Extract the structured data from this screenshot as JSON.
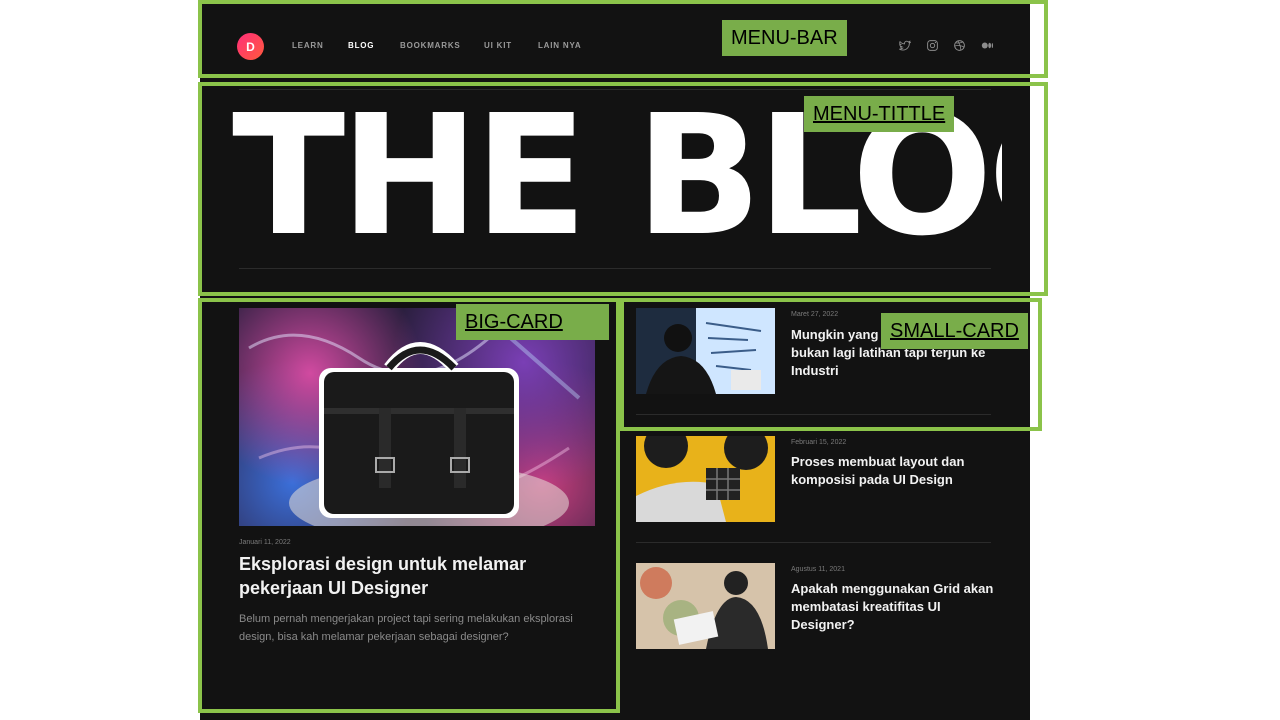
{
  "nav": {
    "logo_letter": "D",
    "items": [
      {
        "label": "LEARN",
        "active": false
      },
      {
        "label": "BLOG",
        "active": true
      },
      {
        "label": "BOOKMARKS",
        "active": false
      },
      {
        "label": "UI KIT",
        "active": false
      },
      {
        "label": "LAIN NYA",
        "active": false
      }
    ],
    "social_icons": [
      "twitter-icon",
      "instagram-icon",
      "dribbble-icon",
      "medium-icon"
    ]
  },
  "hero": {
    "title": "THE BLOG"
  },
  "big_card": {
    "date": "Januari 11, 2022",
    "title": "Eksplorasi design untuk melamar pekerjaan UI Designer",
    "description": "Belum pernah mengerjakan project tapi sering melakukan eksplorasi design, bisa kah melamar pekerjaan sebagai designer?"
  },
  "small_cards": [
    {
      "date": "Maret 27, 2022",
      "title": "Mungkin yang butuhkan saat ini bukan lagi latihan tapi terjun ke Industri"
    },
    {
      "date": "Februari 15, 2022",
      "title": "Proses membuat layout dan komposisi pada UI Design"
    },
    {
      "date": "Agustus 11, 2021",
      "title": "Apakah menggunakan Grid akan membatasi kreatifitas UI Designer?"
    }
  ],
  "annotations": {
    "menu_bar": "MENU-BAR",
    "menu_title": "MENU-TITTLE",
    "big_card": "BIG-CARD",
    "small_card": "SMALL-CARD"
  },
  "colors": {
    "background": "#121212",
    "annotation_green": "#8bc34a",
    "logo_gradient": [
      "#ff2e7a",
      "#ff5a3c"
    ]
  }
}
